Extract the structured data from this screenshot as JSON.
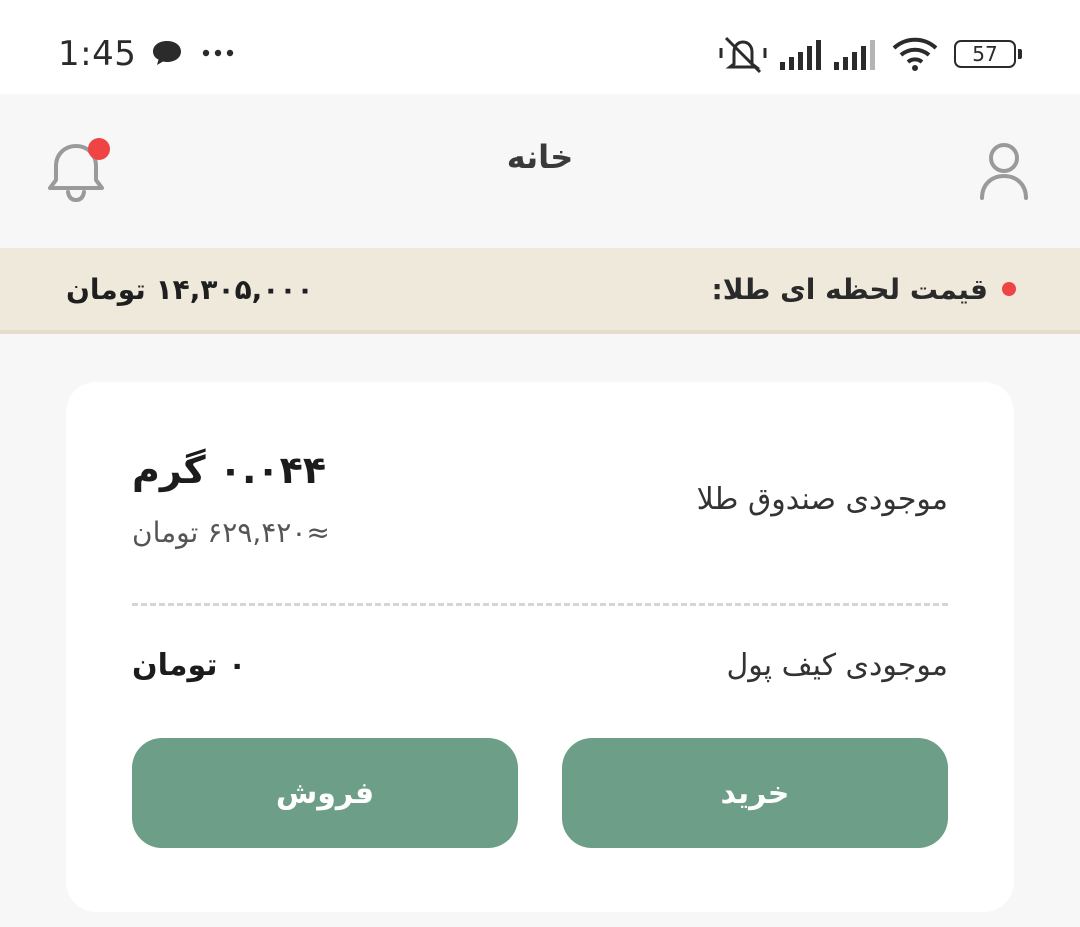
{
  "status_bar": {
    "time": "1:45",
    "battery": "57"
  },
  "header": {
    "title": "خانه"
  },
  "price_bar": {
    "label": "قیمت لحظه ای طلا:",
    "value": "۱۴,۳۰۵,۰۰۰ تومان"
  },
  "card": {
    "gold_label": "موجودی صندوق طلا",
    "gold_amount": "۰.۰۴۴ گرم",
    "gold_approx": "≈۶۲۹,۴۲۰ تومان",
    "wallet_label": "موجودی کیف پول",
    "wallet_value": "۰ تومان",
    "buy_label": "خرید",
    "sell_label": "فروش"
  },
  "colors": {
    "accent": "#6c9e88",
    "price_bar_bg": "#efe9dc",
    "notification_dot": "#f04444"
  },
  "icons": [
    "chat-icon",
    "more-icon",
    "mute-icon",
    "signal-icon",
    "wifi-icon",
    "battery-icon",
    "bell-icon",
    "user-icon"
  ]
}
